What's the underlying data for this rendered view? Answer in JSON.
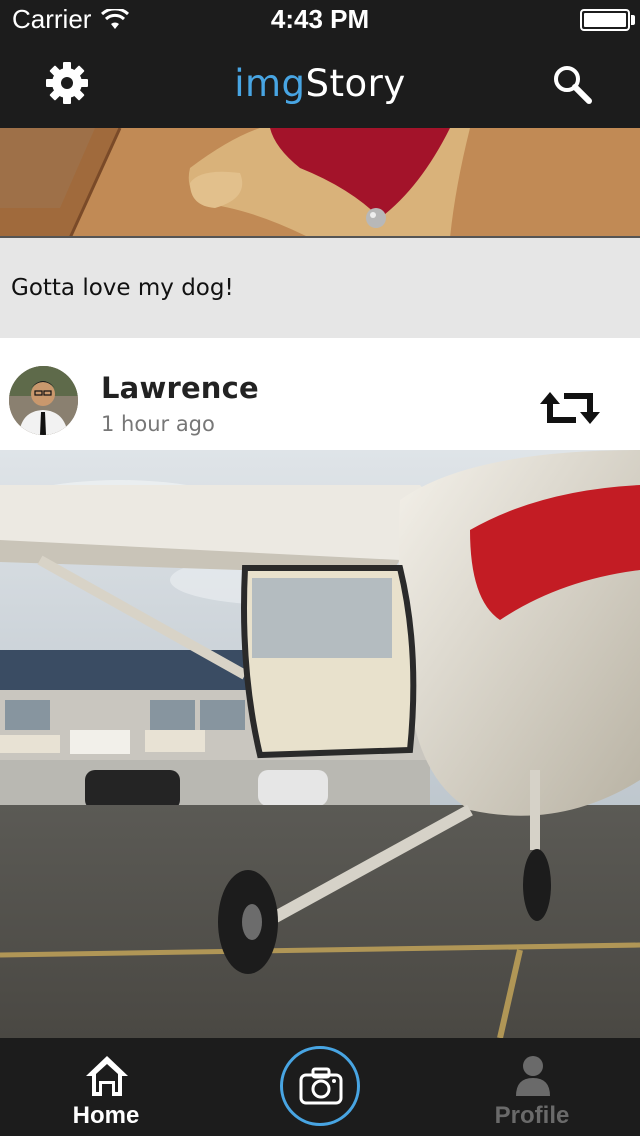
{
  "status_bar": {
    "carrier": "Carrier",
    "time": "4:43 PM",
    "icons": [
      "wifi-icon",
      "battery-icon"
    ]
  },
  "nav_bar": {
    "title_accent": "img",
    "title_rest": "Story",
    "left_icon": "gear-icon",
    "right_icon": "search-icon",
    "accent_color": "#48a5e3"
  },
  "feed": {
    "previous_post": {
      "caption": "Gotta love my dog!"
    },
    "post": {
      "author": "Lawrence",
      "time_ago": "1 hour ago",
      "action_icon": "repost-icon"
    }
  },
  "tab_bar": {
    "home_label": "Home",
    "profile_label": "Profile",
    "camera_icon": "camera-icon",
    "active_tab": "Home"
  }
}
